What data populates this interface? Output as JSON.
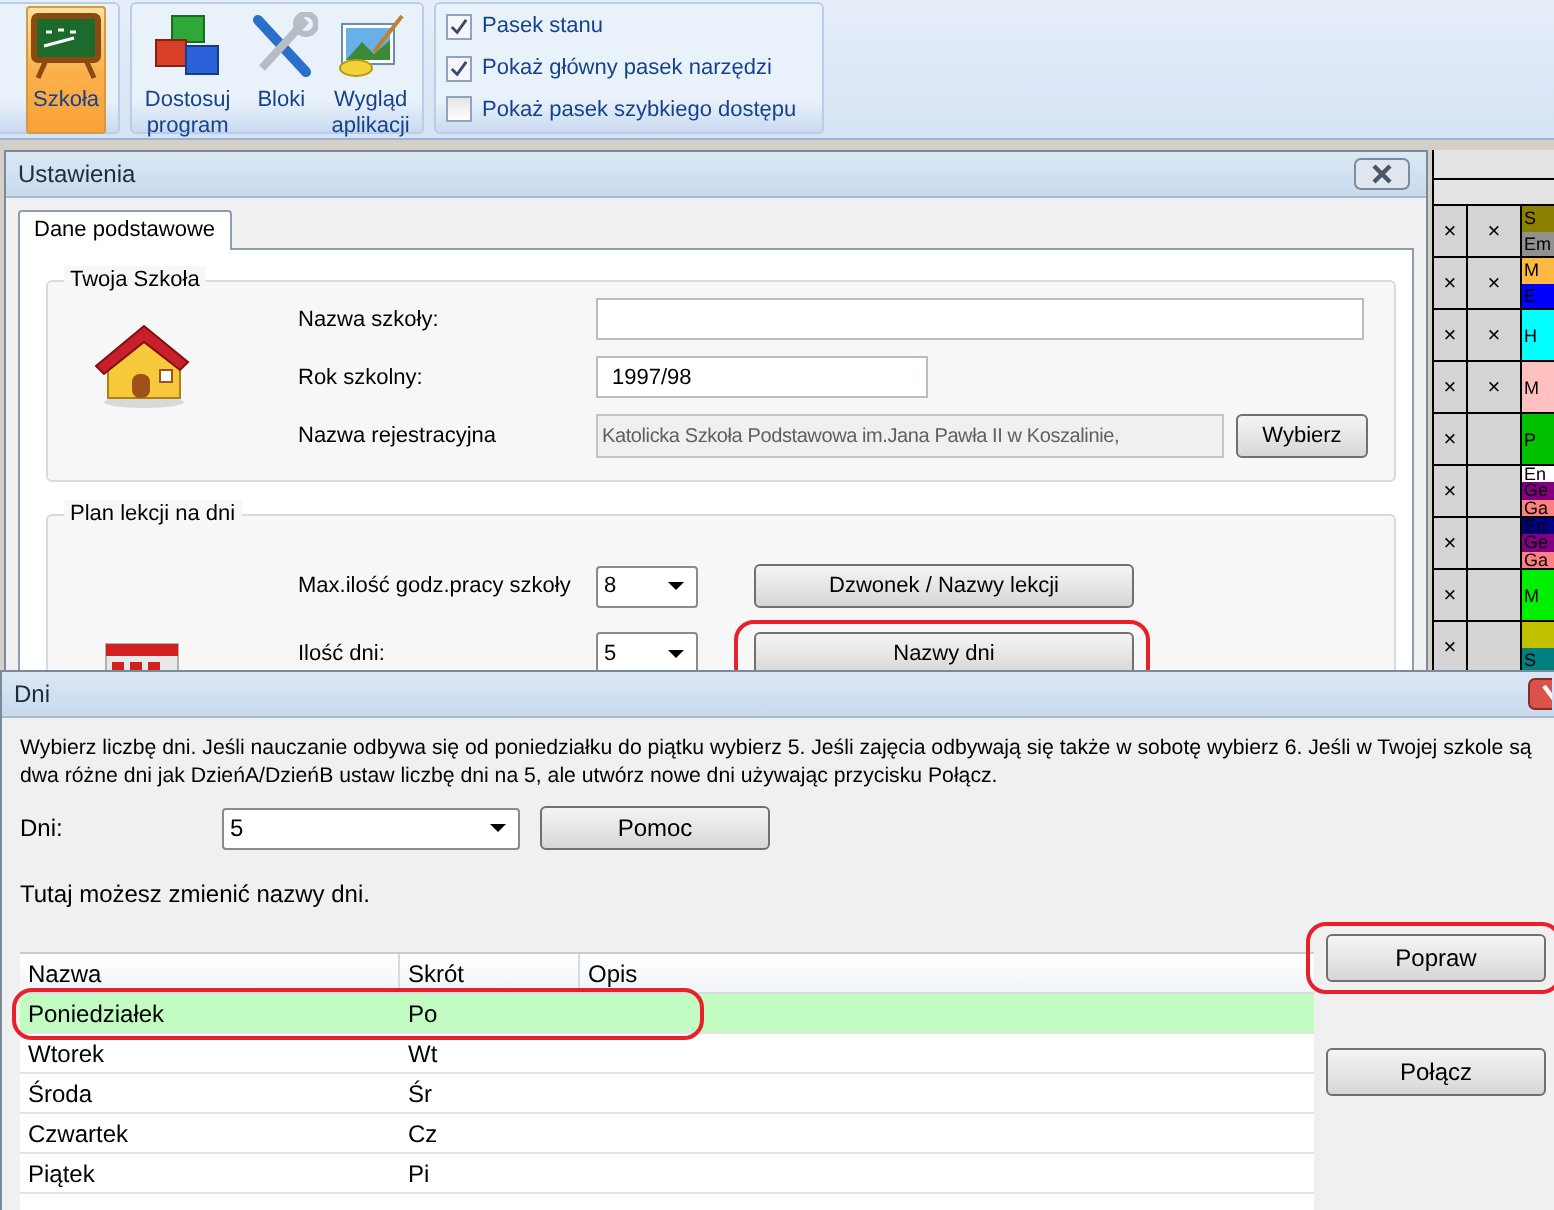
{
  "ribbon": {
    "school_button": {
      "label": "Szkoła",
      "selected": true
    },
    "tools": [
      {
        "label": "Dostosuj program",
        "kind": "cubes"
      },
      {
        "label": "Bloki",
        "kind": "tools"
      },
      {
        "label": "Wygląd aplikacji",
        "kind": "paint"
      }
    ],
    "view_options": [
      {
        "label": "Pasek stanu",
        "checked": true
      },
      {
        "label": "Pokaż główny pasek narzędzi",
        "checked": true
      },
      {
        "label": "Pokaż pasek szybkiego dostępu",
        "checked": false
      }
    ]
  },
  "timetable": {
    "rows": [
      {
        "col_1": "×",
        "col_2": "×",
        "lessons": [
          {
            "text": "S",
            "color": "#8b8000"
          },
          {
            "text": "Em",
            "color": "#909090"
          }
        ]
      },
      {
        "col_1": "×",
        "col_2": "×",
        "lessons": [
          {
            "text": "M",
            "color": "#ffb840"
          },
          {
            "text": "E",
            "color": "#0000ff"
          }
        ]
      },
      {
        "col_1": "×",
        "col_2": "×",
        "lessons": [
          {
            "text": "H",
            "color": "#00ffff"
          }
        ]
      },
      {
        "col_1": "×",
        "col_2": "×",
        "lessons": [
          {
            "text": "M",
            "color": "#ffc0c0"
          }
        ]
      },
      {
        "col_1": "×",
        "lessons": [
          {
            "text": "P",
            "color": "#00c000"
          }
        ]
      },
      {
        "col_1": "×",
        "lessons": [
          {
            "text": "En",
            "color": "#ffffff"
          },
          {
            "text": "Ge",
            "color": "#800080"
          },
          {
            "text": "Ga",
            "color": "#ff8080"
          }
        ]
      },
      {
        "col_1": "×",
        "lessons": [
          {
            "text": "En",
            "color": "#000080"
          },
          {
            "text": "Ge",
            "color": "#800080"
          },
          {
            "text": "Ga",
            "color": "#ff8080"
          }
        ]
      },
      {
        "col_1": "×",
        "lessons": [
          {
            "text": "M",
            "color": "#00ee00"
          }
        ]
      },
      {
        "col_1": "×",
        "lessons": [
          {
            "color": "#c0c000"
          },
          {
            "text": "S",
            "color": "#008080"
          }
        ]
      }
    ]
  },
  "settings_window": {
    "title": "Ustawienia",
    "tabs": [
      {
        "label": "Dane podstawowe",
        "selected": true
      }
    ],
    "school_group": {
      "title": "Twoja Szkoła",
      "fields": [
        {
          "label": "Nazwa szkoły:",
          "kind": "wide",
          "disabled": false
        },
        {
          "label": "Rok szkolny:",
          "value": "1997/98",
          "kind": "short",
          "disabled": false
        },
        {
          "label": "Nazwa rejestracyjna",
          "value": "Katolicka Szkoła Podstawowa im.Jana Pawła II w Koszalinie,",
          "kind": "with-button",
          "disabled": true,
          "button": "Wybierz"
        }
      ]
    },
    "plan_group": {
      "title": "Plan lekcji na dni",
      "rows": [
        {
          "label": "Max.ilość godz.pracy szkoły",
          "value": "8",
          "button": {
            "label": "Dzwonek / Nazwy lekcji",
            "highlighted": false
          }
        },
        {
          "label": "Ilość dni:",
          "value": "5",
          "button": {
            "label": "Nazwy dni",
            "highlighted": true
          }
        }
      ]
    }
  },
  "days_dialog": {
    "title": "Dni",
    "intro": "Wybierz liczbę dni. Jeśli nauczanie odbywa się od poniedziałku do piątku wybierz 5. Jeśli zajęcia odbywają się także w sobotę wybierz 6. Jeśli w Twojej szkole są dwa różne dni jak DzieńA/DzieńB ustaw liczbę dni na 5, ale utwórz nowe dni używając przycisku Połącz.",
    "days_label": "Dni:",
    "days_value": "5",
    "help_button": "Pomoc",
    "table_caption": "Tutaj możesz zmienić nazwy dni.",
    "table": {
      "columns": [
        "Nazwa",
        "Skrót",
        "Opis"
      ],
      "rows": [
        {
          "name": "Poniedziałek",
          "short": "Po",
          "selected": true,
          "highlighted": true
        },
        {
          "name": "Wtorek",
          "short": "Wt",
          "selected": false,
          "highlighted": false
        },
        {
          "name": "Środa",
          "short": "Śr",
          "selected": false,
          "highlighted": false
        },
        {
          "name": "Czwartek",
          "short": "Cz",
          "selected": false,
          "highlighted": false
        },
        {
          "name": "Piątek",
          "short": "Pi",
          "selected": false,
          "highlighted": false
        }
      ]
    },
    "buttons": [
      {
        "label": "Popraw",
        "highlighted": true
      },
      {
        "label": "Połącz",
        "highlighted": false
      }
    ]
  }
}
